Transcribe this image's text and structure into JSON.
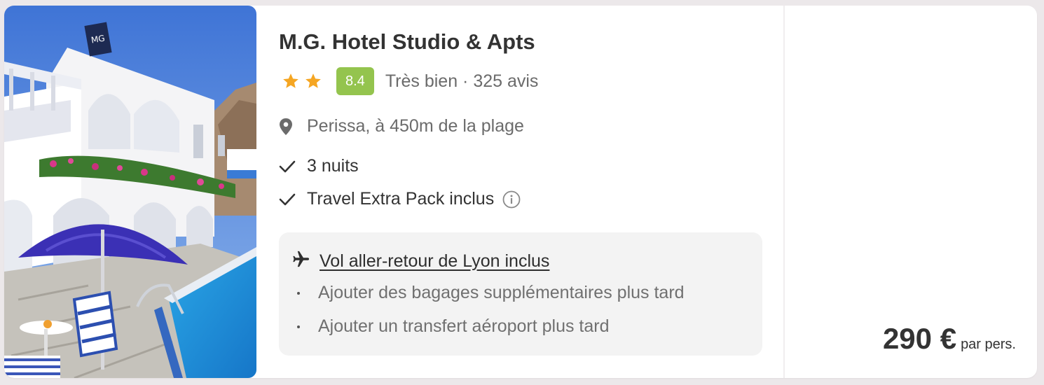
{
  "hotel": {
    "name": "M.G. Hotel Studio & Apts",
    "star_count": 2,
    "score": "8.4",
    "review_summary": "Très bien · 325 avis",
    "location": "Perissa, à 450m de la plage",
    "features": [
      "3 nuits",
      "Travel Extra Pack inclus"
    ],
    "photo_sign": "MG"
  },
  "flight": {
    "title": "Vol aller-retour de Lyon inclus",
    "options": [
      "Ajouter des bagages supplémentaires plus tard",
      "Ajouter un transfert aéroport plus tard"
    ]
  },
  "price": {
    "amount": "290 €",
    "unit": "par pers."
  },
  "colors": {
    "star": "#f5a623",
    "score_badge": "#94c44e",
    "card_bg": "#ffffff",
    "page_bg": "#ece8ea",
    "flight_box_bg": "#f3f3f3"
  },
  "icons": {
    "star": "star-icon",
    "location": "map-pin-icon",
    "check": "checkmark-icon",
    "info": "info-circle-icon",
    "flight": "airplane-icon",
    "bullet": "bullet-dot-icon"
  }
}
